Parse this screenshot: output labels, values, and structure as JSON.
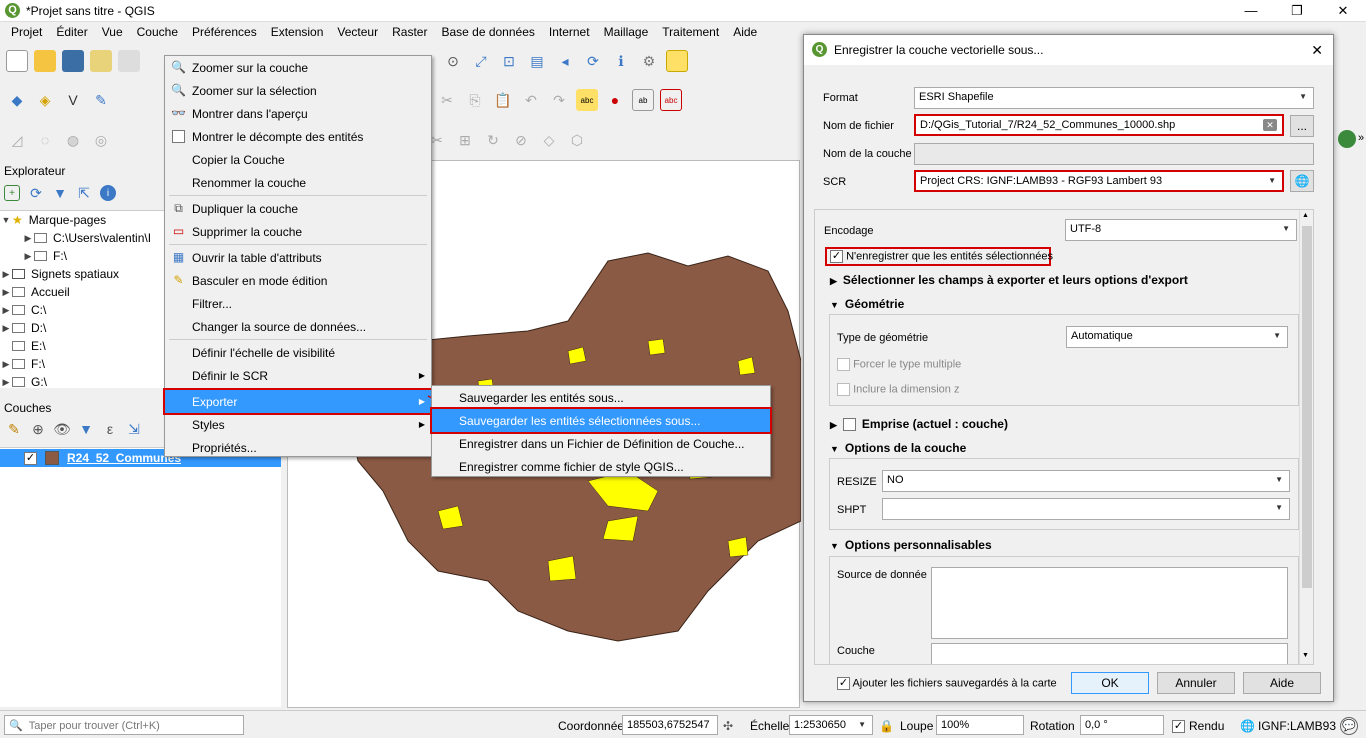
{
  "window": {
    "title": "*Projet sans titre - QGIS"
  },
  "menubar": [
    "Projet",
    "Éditer",
    "Vue",
    "Couche",
    "Préférences",
    "Extension",
    "Vecteur",
    "Raster",
    "Base de données",
    "Internet",
    "Maillage",
    "Traitement",
    "Aide"
  ],
  "explorer": {
    "title": "Explorateur",
    "items": [
      "Marque-pages",
      "C:\\Users\\valentin\\I",
      "F:\\",
      "Signets spatiaux",
      "Accueil",
      "C:\\",
      "D:\\",
      "E:\\",
      "F:\\",
      "G:\\"
    ]
  },
  "layers": {
    "title": "Couches",
    "layer_name": "R24_52_Communes"
  },
  "context_menu": {
    "items": [
      "Zoomer sur la couche",
      "Zoomer sur la sélection",
      "Montrer dans l'aperçu",
      "Montrer le décompte des entités",
      "Copier la Couche",
      "Renommer la couche",
      "Dupliquer la couche",
      "Supprimer la couche",
      "Ouvrir la table d'attributs",
      "Basculer en mode édition",
      "Filtrer...",
      "Changer la source de données...",
      "Définir l'échelle de visibilité",
      "Définir le SCR",
      "Exporter",
      "Styles",
      "Propriétés..."
    ]
  },
  "export_submenu": [
    "Sauvegarder les entités sous...",
    "Sauvegarder les entités sélectionnées sous...",
    "Enregistrer dans un Fichier de Définition de Couche...",
    "Enregistrer comme fichier de style QGIS..."
  ],
  "dialog": {
    "title": "Enregistrer la couche vectorielle sous...",
    "format_label": "Format",
    "format_value": "ESRI Shapefile",
    "filename_label": "Nom de fichier",
    "filename_value": "D:/QGis_Tutorial_7/R24_52_Communes_10000.shp",
    "browse": "...",
    "layername_label": "Nom de la couche",
    "scr_label": "SCR",
    "scr_value": "Project CRS: IGNF:LAMB93 - RGF93 Lambert 93",
    "encoding_label": "Encodage",
    "encoding_value": "UTF-8",
    "selected_only": "N'enregistrer que les entités sélectionnées",
    "fields_group": "Sélectionner les champs à exporter et leurs options d'export",
    "geometry_group": "Géométrie",
    "geomtype_label": "Type de géométrie",
    "geomtype_value": "Automatique",
    "force_multi": "Forcer le type multiple",
    "include_z": "Inclure la dimension z",
    "extent_group": "Emprise (actuel : couche)",
    "layer_options_group": "Options de la couche",
    "resize_label": "RESIZE",
    "resize_value": "NO",
    "shpt_label": "SHPT",
    "custom_group": "Options personnalisables",
    "datasource_label": "Source de donnée",
    "couche_label": "Couche",
    "add_to_map": "Ajouter les fichiers sauvegardés à la carte",
    "ok": "OK",
    "cancel": "Annuler",
    "help": "Aide"
  },
  "statusbar": {
    "search_placeholder": "Taper pour trouver (Ctrl+K)",
    "coord_label": "Coordonnée",
    "coord_value": "185503,6752547",
    "scale_label": "Échelle",
    "scale_value": "1:2530650",
    "zoom_label": "Loupe",
    "zoom_value": "100%",
    "rotation_label": "Rotation",
    "rotation_value": "0,0 °",
    "render_label": "Rendu",
    "crs_value": "IGNF:LAMB93"
  },
  "colors": {
    "map_fill": "#8b5a45",
    "selected_fill": "#ffff00",
    "highlight": "#3399ff",
    "annotation_red": "#d40000"
  }
}
